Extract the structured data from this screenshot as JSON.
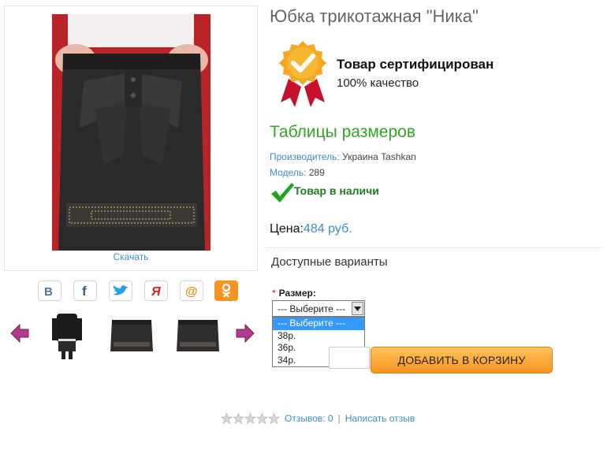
{
  "product": {
    "title": "Юбка трикотажная \"Ника\"",
    "download_label": "Скачать",
    "certificate": {
      "title": "Товар сертифицирован",
      "subtitle": "100% качество"
    },
    "size_tables_label": "Таблицы размеров",
    "manufacturer": {
      "label": "Производитель:",
      "value": "Украина Tashkan"
    },
    "model": {
      "label": "Модель:",
      "value": "289"
    },
    "stock_status": "Товар в наличи",
    "price": {
      "label": "Цена:",
      "value": "484 руб."
    }
  },
  "share": [
    {
      "name": "vkontakte",
      "glyph": "B",
      "color": "#4a76a8"
    },
    {
      "name": "facebook",
      "glyph": "f",
      "color": "#3b5998"
    },
    {
      "name": "twitter",
      "glyph": "twitter-bird",
      "color": "#1da1f2"
    },
    {
      "name": "yaru",
      "glyph": "Я",
      "color": "#e02020"
    },
    {
      "name": "mailru",
      "glyph": "@",
      "color": "#f28c0f"
    },
    {
      "name": "odnoklassniki",
      "glyph": "ok",
      "color": "#f7931e"
    }
  ],
  "variants": {
    "title": "Доступные варианты",
    "size_label": "Размер:",
    "required_mark": "*",
    "selected": "--- Выберите ---",
    "options": [
      "--- Выберите ---",
      "38р.",
      "36р.",
      "34р."
    ]
  },
  "cart": {
    "button_label": "ДОБАВИТЬ В КОРЗИНУ"
  },
  "reviews": {
    "rating": 0,
    "max_rating": 5,
    "count_label": "Отзывов: 0",
    "separator": "|",
    "write_label": "Написать отзыв"
  },
  "colors": {
    "accent_green": "#2fa81f",
    "link_blue": "#3b8fc4",
    "cart_orange": "#f7941d",
    "thumb_arrow": "#b23a8a"
  }
}
